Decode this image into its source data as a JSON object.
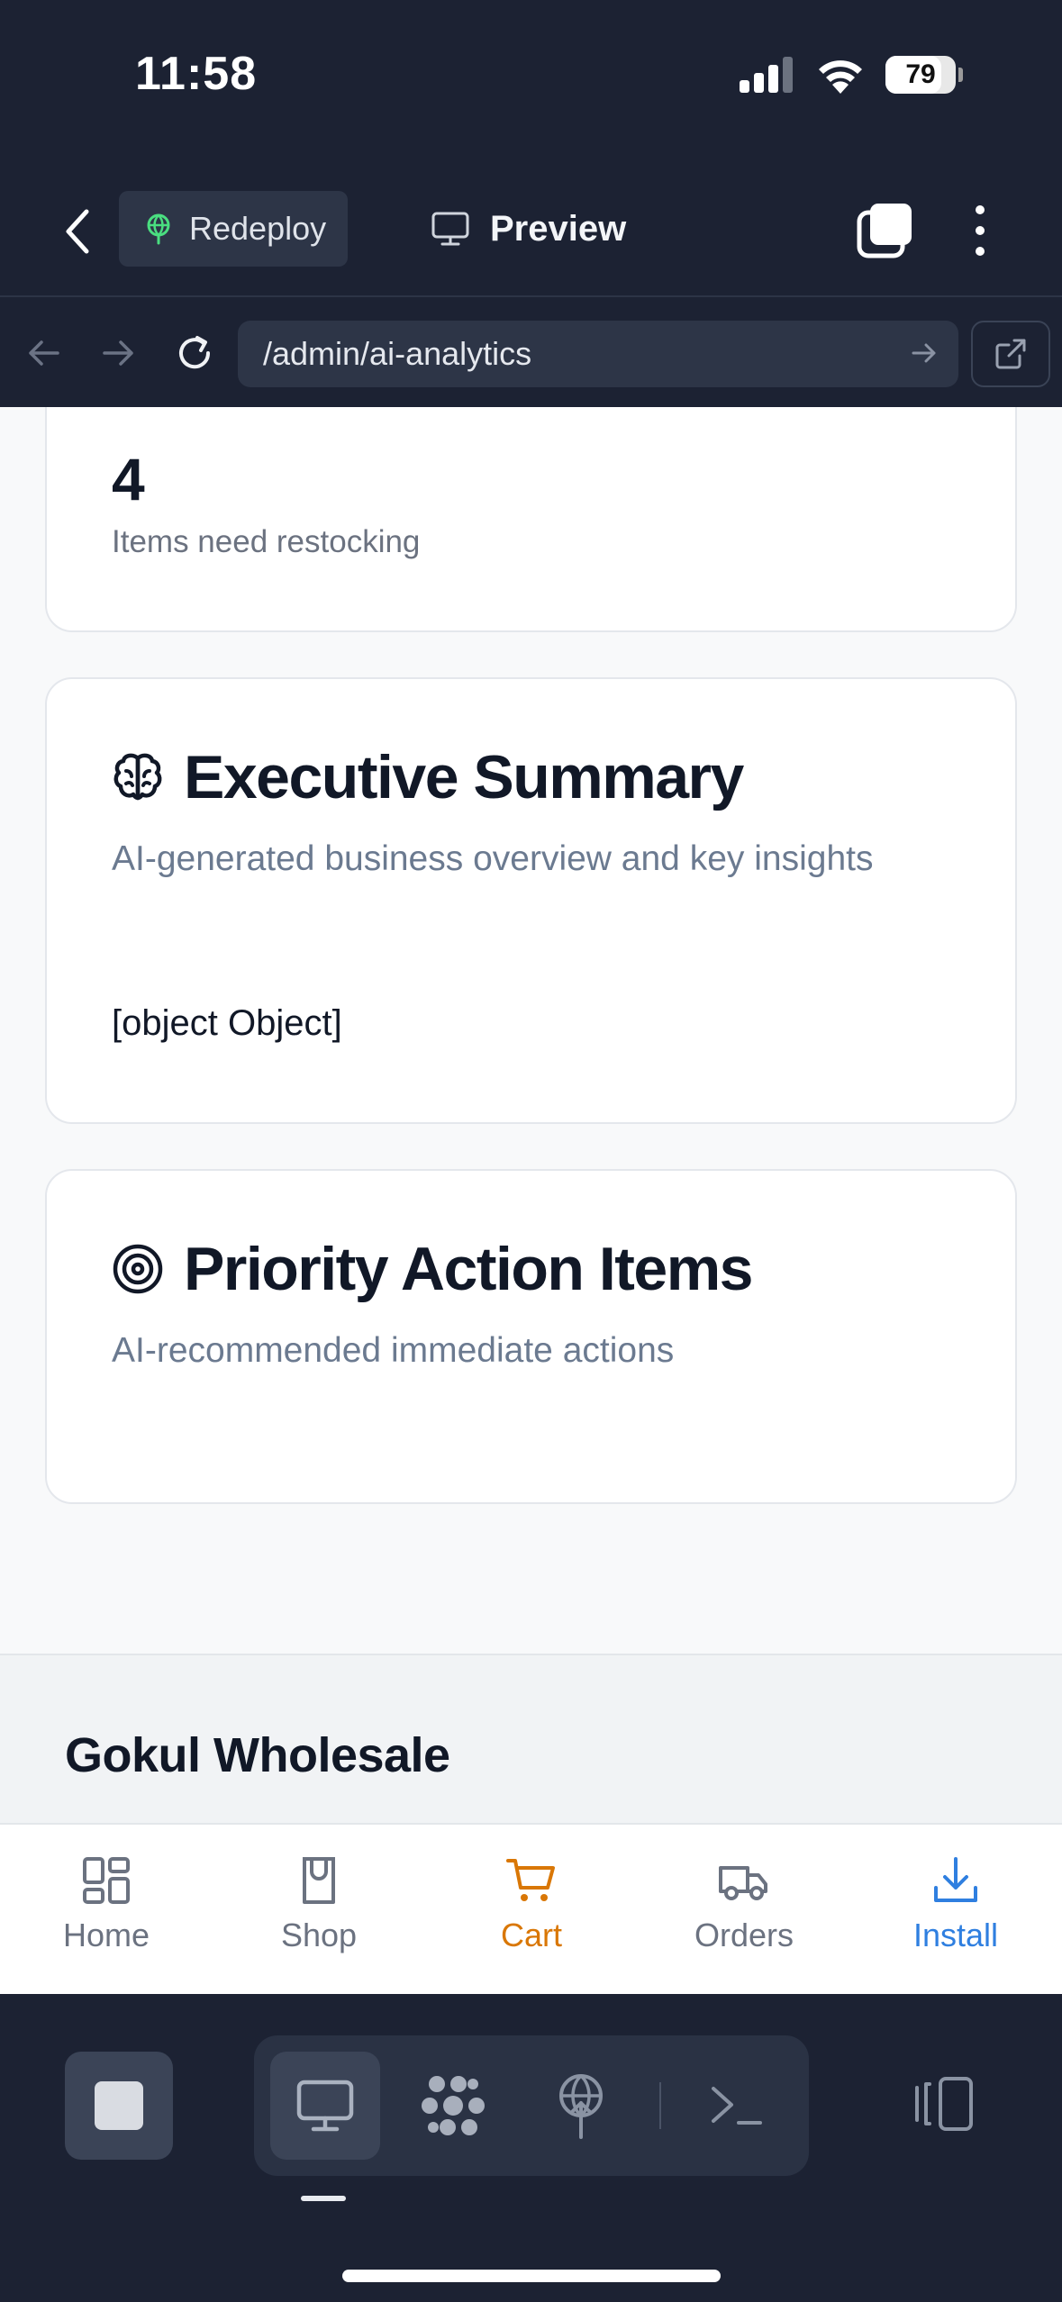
{
  "status_bar": {
    "time": "11:58",
    "battery": "79",
    "battery_level": 0.79
  },
  "app_bar": {
    "redeploy_label": "Redeploy",
    "preview_label": "Preview"
  },
  "url_bar": {
    "url": "/admin/ai-analytics"
  },
  "content": {
    "metric_card": {
      "value": "4",
      "label": "Items need restocking"
    },
    "executive_summary": {
      "icon": "brain-icon",
      "title": "Executive Summary",
      "description": "AI-generated business overview and key insights",
      "body": "[object Object]"
    },
    "priority_actions": {
      "icon": "target-icon",
      "title": "Priority Action Items",
      "description": "AI-recommended immediate actions"
    },
    "footer": {
      "brand": "Gokul Wholesale"
    }
  },
  "bottom_nav": {
    "items": [
      {
        "label": "Home",
        "icon": "grid-icon",
        "color": "#6b7280"
      },
      {
        "label": "Shop",
        "icon": "shopping-bag-icon",
        "color": "#6b7280"
      },
      {
        "label": "Cart",
        "icon": "cart-icon",
        "color": "#d97706"
      },
      {
        "label": "Orders",
        "icon": "truck-icon",
        "color": "#6b7280"
      },
      {
        "label": "Install",
        "icon": "download-icon",
        "color": "#2f7fe0"
      }
    ]
  },
  "ide_toolbar": {
    "buttons": [
      "stop-icon",
      "desktop-icon",
      "apps-icon",
      "deploy-icon",
      "terminal-icon",
      "panel-icon"
    ]
  },
  "colors": {
    "dark_bg": "#1c2233",
    "accent_cart": "#d97706",
    "accent_install": "#2f7fe0",
    "redeploy_green": "#4ade80"
  }
}
